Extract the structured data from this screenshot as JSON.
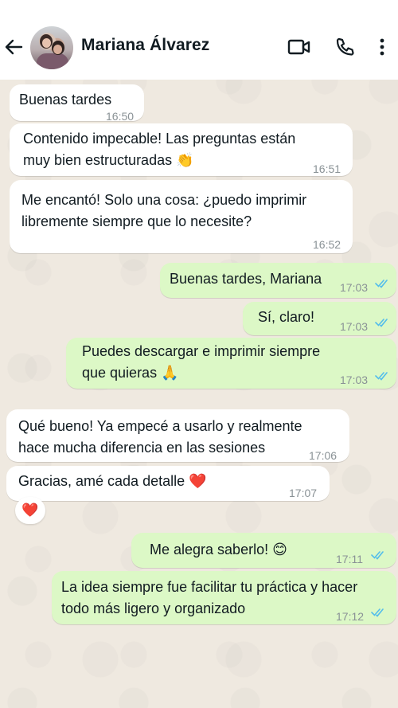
{
  "header": {
    "contact_name": "Mariana Álvarez",
    "icons": [
      "back-arrow-icon",
      "avatar",
      "video-call-icon",
      "voice-call-icon",
      "more-options-icon"
    ]
  },
  "messages": [
    {
      "direction": "in",
      "text": "Buenas tardes",
      "time": "16:50"
    },
    {
      "direction": "in",
      "text": "Contenido impecable! Las preguntas están\nmuy bien estructuradas 👏",
      "time": "16:51"
    },
    {
      "direction": "in",
      "text": "Me encantó! Solo una cosa: ¿puedo imprimir\nlibremente siempre que lo necesite?",
      "time": "16:52"
    },
    {
      "direction": "out",
      "text": "Buenas tardes, Mariana",
      "time": "17:03",
      "status": "read"
    },
    {
      "direction": "out",
      "text": "Sí, claro!",
      "time": "17:03",
      "status": "read"
    },
    {
      "direction": "out",
      "text": "Puedes descargar e imprimir siempre\nque quieras 🙏",
      "time": "17:03",
      "status": "read"
    },
    {
      "direction": "in",
      "text": "Qué bueno! Ya empecé a usarlo y realmente\nhace mucha diferencia en las sesiones",
      "time": "17:06"
    },
    {
      "direction": "in",
      "text": "Gracias, amé cada detalle ❤️",
      "time": "17:07",
      "reaction": "❤️"
    },
    {
      "direction": "out",
      "text": "Me alegra saberlo! 😊",
      "time": "17:11",
      "status": "read"
    },
    {
      "direction": "out",
      "text": "La idea siempre fue facilitar tu práctica y hacer\ntodo más ligero y organizado",
      "time": "17:12",
      "status": "read"
    }
  ],
  "colors": {
    "incoming_bubble": "#ffffff",
    "outgoing_bubble": "#dcf8c6",
    "read_ticks": "#53bdeb",
    "chat_background": "#efe9e0"
  }
}
